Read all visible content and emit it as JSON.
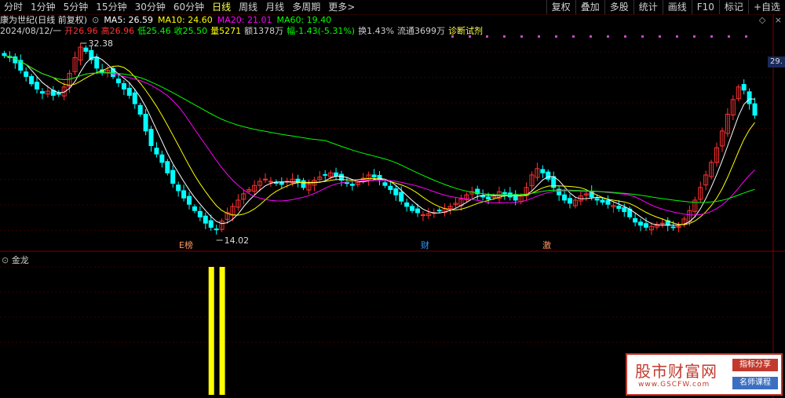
{
  "tabs": [
    "分时",
    "1分钟",
    "5分钟",
    "15分钟",
    "30分钟",
    "60分钟",
    "日线",
    "周线",
    "月线",
    "多周期",
    "更多>"
  ],
  "active_tab": "日线",
  "right_buttons": [
    "复权",
    "叠加",
    "多股",
    "统计",
    "画线",
    "F10",
    "标记",
    "+自选"
  ],
  "info": {
    "title": "康为世纪(日线 前复权)",
    "ma5": "MA5: 26.59",
    "ma10": "MA10: 24.60",
    "ma20": "MA20: 21.01",
    "ma60": "MA60: 19.40",
    "date": "2024/08/12/一",
    "open": "开26.96",
    "high": "高26.96",
    "low": "低25.46",
    "close": "收25.50",
    "vol": "量5271",
    "amount": "额1378万",
    "change": "幅-1.43(-5.31%)",
    "turnover": "换1.43%",
    "float": "流通3699万",
    "diag": "诊断试剂"
  },
  "colors": {
    "up": "#ff3232",
    "down": "#00ffff",
    "ma5": "#ffffff",
    "ma10": "#ffff00",
    "ma20": "#ff00ff",
    "ma60": "#00ff00",
    "bar": "#ffff00",
    "bg": "#000000"
  },
  "annotations": {
    "high_label": "32.38",
    "low_label": "14.02",
    "mark1": "E榜",
    "mark2": "财",
    "mark3": "激"
  },
  "price_tag": "29.",
  "indicator_name": "金龙",
  "watermark": {
    "title": "股市财富网",
    "url": "www.GSCFW.com",
    "badge1": "指标分享",
    "badge2": "名师课程"
  },
  "chart_data": {
    "type": "candlestick",
    "closes": [
      31.2,
      31.0,
      30.5,
      29.8,
      29.2,
      28.5,
      28.0,
      27.6,
      27.8,
      27.4,
      27.5,
      28.2,
      29.5,
      31.0,
      32.0,
      31.6,
      30.8,
      30.0,
      29.6,
      29.8,
      29.2,
      28.6,
      28.0,
      27.4,
      26.6,
      25.6,
      24.0,
      22.6,
      21.8,
      21.0,
      20.0,
      19.0,
      18.3,
      17.6,
      17.0,
      16.4,
      15.8,
      15.2,
      14.8,
      14.6,
      15.4,
      16.2,
      16.8,
      17.4,
      18.0,
      18.4,
      18.8,
      19.2,
      19.4,
      19.2,
      19.0,
      18.9,
      19.2,
      19.4,
      19.1,
      18.6,
      18.9,
      19.3,
      19.6,
      19.8,
      20.0,
      19.7,
      19.3,
      19.0,
      18.8,
      19.1,
      19.5,
      19.8,
      19.6,
      19.3,
      18.8,
      18.4,
      17.9,
      17.3,
      16.8,
      16.4,
      16.2,
      16.0,
      16.1,
      16.2,
      16.4,
      16.6,
      16.8,
      17.1,
      17.5,
      17.9,
      18.2,
      18.0,
      17.7,
      17.5,
      17.8,
      18.2,
      18.0,
      17.7,
      17.4,
      17.8,
      18.6,
      19.8,
      20.4,
      20.0,
      19.4,
      18.6,
      17.9,
      17.4,
      17.1,
      17.4,
      17.8,
      18.0,
      17.7,
      17.4,
      17.2,
      17.0,
      16.9,
      16.6,
      16.3,
      15.8,
      15.3,
      15.0,
      14.8,
      14.9,
      15.1,
      15.2,
      15.0,
      14.8,
      14.9,
      15.6,
      16.4,
      17.4,
      18.6,
      19.8,
      21.0,
      22.4,
      24.0,
      25.6,
      27.0,
      28.2,
      27.9,
      26.6,
      25.5
    ],
    "indicator_bars": [
      {
        "index": 38,
        "value": 1.0
      },
      {
        "index": 40,
        "value": 1.0
      }
    ],
    "ylim": [
      14.02,
      32.38
    ]
  }
}
